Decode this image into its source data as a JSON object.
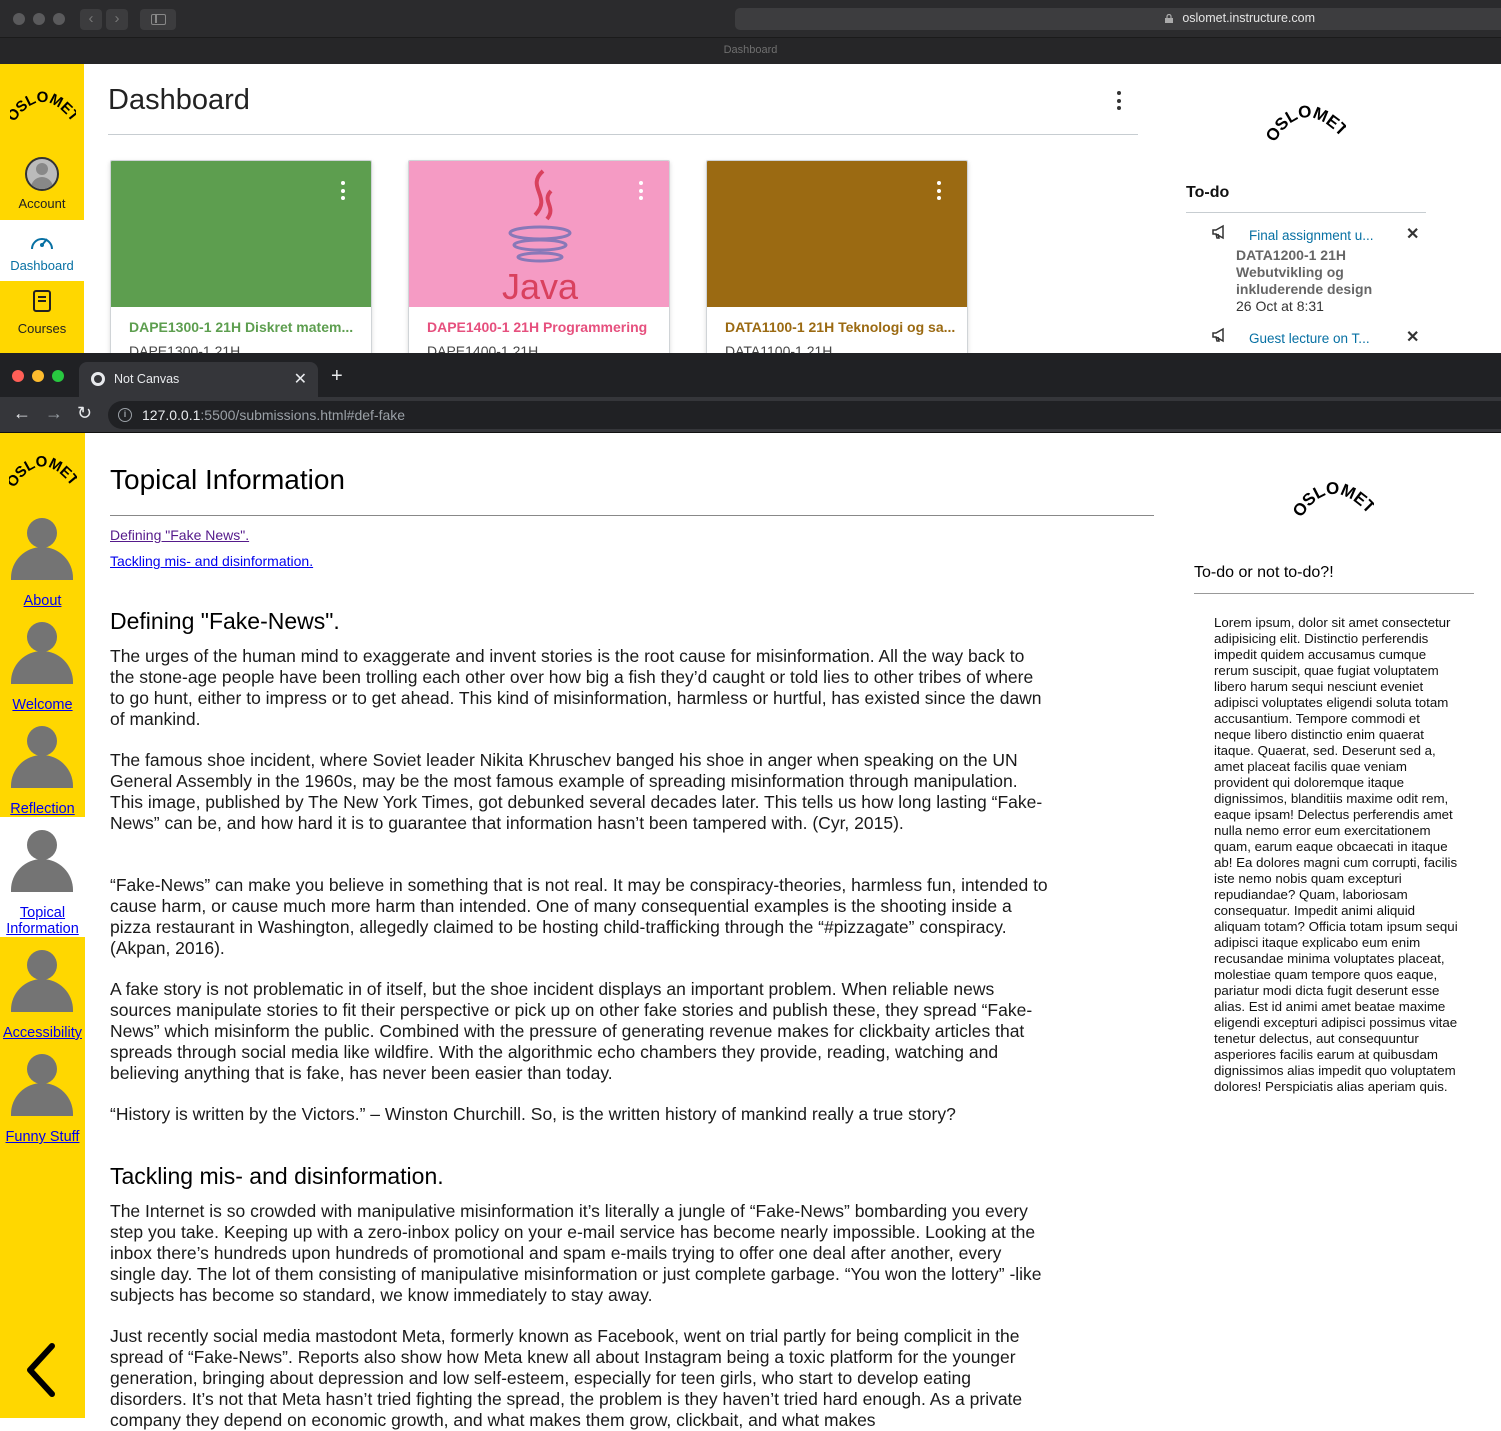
{
  "window1": {
    "address": "oslomet.instructure.com",
    "tab_title": "Dashboard",
    "logo": "OSLOMET",
    "nav": [
      {
        "label": "Account"
      },
      {
        "label": "Dashboard"
      },
      {
        "label": "Courses"
      }
    ],
    "page_title": "Dashboard",
    "cards": [
      {
        "title": "DAPE1300-1 21H Diskret matem...",
        "code": "DAPE1300-1 21H",
        "color": "#5d9e4f"
      },
      {
        "title": "DAPE1400-1 21H Programmering",
        "code": "DAPE1400-1 21H",
        "color": "#f59bc4",
        "image_text": "Java"
      },
      {
        "title": "DATA1100-1 21H Teknologi og sa...",
        "code": "DATA1100-1 21H",
        "color": "#9b6a12"
      }
    ],
    "todo": {
      "heading": "To-do",
      "items": [
        {
          "title": "Final assignment u...",
          "course_line1": "DATA1200-1 21H",
          "course_line2": "Webutvikling og",
          "course_line3": "inkluderende design",
          "date": "26 Oct at 8:31"
        },
        {
          "title": "Guest lecture on T..."
        }
      ]
    }
  },
  "window2": {
    "tab_title": "Not Canvas",
    "url_host": "127.0.0.1",
    "url_rest": ":5500/submissions.html#def-fake",
    "logo": "OSLOMET",
    "nav": [
      {
        "label": "About"
      },
      {
        "label": "Welcome"
      },
      {
        "label": "Reflection"
      },
      {
        "label_line1": "Topical",
        "label_line2": "Information"
      },
      {
        "label": "Accessibility"
      },
      {
        "label": "Funny Stuff"
      }
    ],
    "page_title": "Topical Information",
    "toc": [
      "Defining \"Fake News\".",
      "Tackling mis- and disinformation."
    ],
    "section1": {
      "heading": "Defining \"Fake-News\".",
      "paragraphs": [
        "The urges of the human mind to exaggerate and invent stories is the root cause for misinformation. All the way back to the stone-age people have been trolling each other over how big a fish they’d caught or told lies to other tribes of where to go hunt, either to impress or to get ahead. This kind of misinformation, harmless or hurtful, has existed since the dawn of mankind.",
        "The famous shoe incident, where Soviet leader Nikita Khruschev banged his shoe in anger when speaking on the UN General Assembly in the 1960s, may be the most famous example of spreading misinformation through manipulation. This image, published by The New York Times, got debunked several decades later. This tells us how long lasting “Fake-News” can be, and how hard it is to guarantee that information hasn’t been tampered with. (Cyr, 2015).",
        "“Fake-News” can make you believe in something that is not real. It may be conspiracy-theories, harmless fun, intended to cause harm, or cause much more harm than intended. One of many consequential examples is the shooting inside a pizza restaurant in Washington, allegedly claimed to be hosting child-trafficking through the “#pizzagate” conspiracy. (Akpan, 2016).",
        "A fake story is not problematic in of itself, but the shoe incident displays an important problem. When reliable news sources manipulate stories to fit their perspective or pick up on other fake stories and publish these, they spread “Fake-News” which misinform the public. Combined with the pressure of generating revenue makes for clickbaity articles that spreads through social media like wildfire. With the algorithmic echo chambers they provide, reading, watching and believing anything that is fake, has never been easier than today.",
        "“History is written by the Victors.” – Winston Churchill. So, is the written history of mankind really a true story?"
      ]
    },
    "section2": {
      "heading": "Tackling mis- and disinformation.",
      "paragraphs": [
        "The Internet is so crowded with manipulative misinformation it’s literally a jungle of “Fake-News” bombarding you every step you take. Keeping up with a zero-inbox policy on your e-mail service has become nearly impossible. Looking at the inbox there’s hundreds upon hundreds of promotional and spam e-mails trying to offer one deal after another, every single day. The lot of them consisting of manipulative misinformation or just complete garbage. “You won the lottery” -like subjects has become so standard, we know immediately to stay away.",
        "Just recently social media mastodont Meta, formerly known as Facebook, went on trial partly for being complicit in the spread of “Fake-News”. Reports also show how Meta knew all about Instagram being a toxic platform for the younger generation, bringing about depression and low self-esteem, especially for teen girls, who start to develop eating disorders. It’s not that Meta hasn’t tried fighting the spread, the problem is they haven’t tried hard enough. As a private company they depend on economic growth, and what makes them grow, clickbait, and what makes"
      ]
    },
    "todo": {
      "heading": "To-do or not to-do?!",
      "text": "Lorem ipsum, dolor sit amet consectetur adipisicing elit. Distinctio perferendis impedit quidem accusamus cumque rerum suscipit, quae fugiat voluptatem libero harum sequi nesciunt eveniet adipisci voluptates eligendi soluta totam accusantium. Tempore commodi et neque libero distinctio enim quaerat itaque. Quaerat, sed. Deserunt sed a, amet placeat facilis quae veniam provident qui doloremque itaque dignissimos, blanditiis maxime odit rem, eaque ipsam! Delectus perferendis amet nulla nemo error eum exercitationem quam, earum eaque obcaecati in itaque ab! Ea dolores magni cum corrupti, facilis iste nemo nobis quam excepturi repudiandae? Quam, laboriosam consequatur. Impedit animi aliquid aliquam totam? Officia totam ipsum sequi adipisci itaque explicabo eum enim recusandae minima voluptates placeat, molestiae quam tempore quos eaque, pariatur modi dicta fugit deserunt esse alias. Est id animi amet beatae maxime eligendi excepturi adipisci possimus vitae tenetur delectus, aut consequuntur asperiores facilis earum at quibusdam dignissimos alias impedit quo voluptatem dolores! Perspiciatis alias aperiam quis."
    }
  },
  "colors": {
    "brand_yellow": "#ffd700",
    "canvas_link": "#0770a3"
  }
}
